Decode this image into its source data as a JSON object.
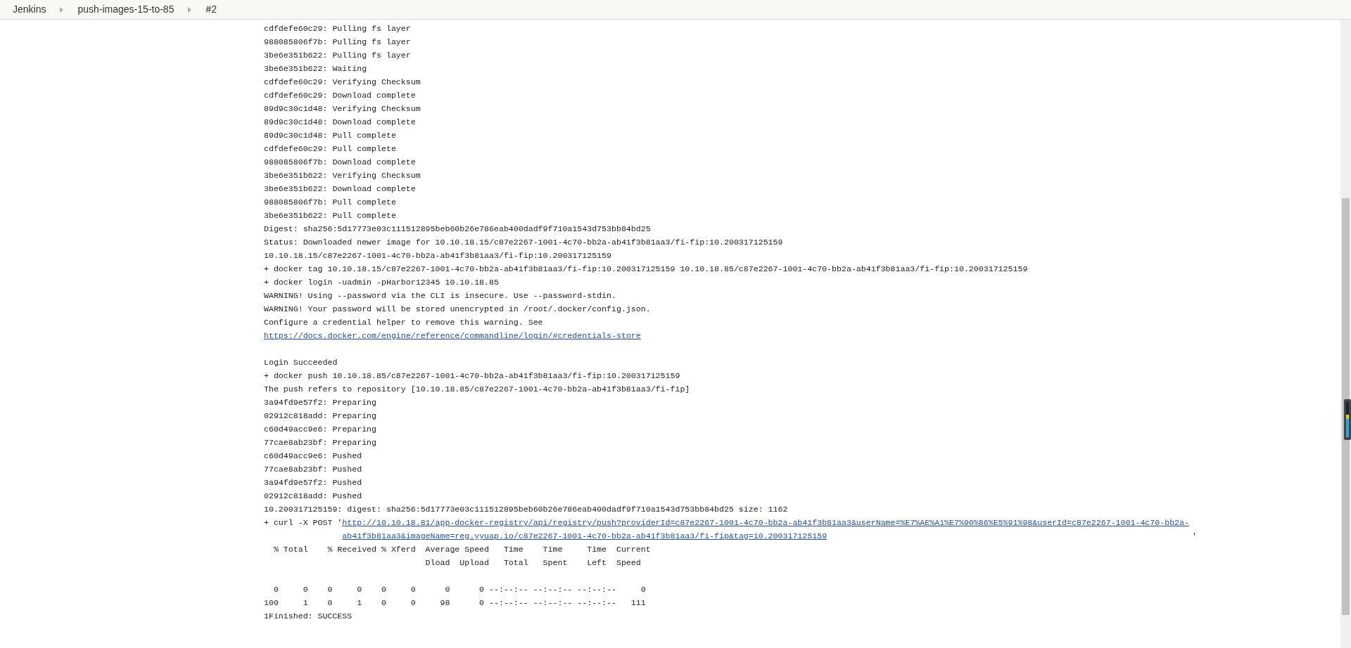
{
  "breadcrumbs": [
    {
      "label": "Jenkins"
    },
    {
      "label": "push-images-15-to-85"
    },
    {
      "label": "#2"
    }
  ],
  "console": [
    {
      "kind": "text",
      "text": "cdfdefe60c29: Pulling fs layer"
    },
    {
      "kind": "text",
      "text": "988085806f7b: Pulling fs layer"
    },
    {
      "kind": "text",
      "text": "3be6e351b622: Pulling fs layer"
    },
    {
      "kind": "text",
      "text": "3be6e351b622: Waiting"
    },
    {
      "kind": "text",
      "text": "cdfdefe60c29: Verifying Checksum"
    },
    {
      "kind": "text",
      "text": "cdfdefe60c29: Download complete"
    },
    {
      "kind": "text",
      "text": "89d9c30c1d48: Verifying Checksum"
    },
    {
      "kind": "text",
      "text": "89d9c30c1d48: Download complete"
    },
    {
      "kind": "text",
      "text": "89d9c30c1d48: Pull complete"
    },
    {
      "kind": "text",
      "text": "cdfdefe60c29: Pull complete"
    },
    {
      "kind": "text",
      "text": "988085806f7b: Download complete"
    },
    {
      "kind": "text",
      "text": "3be6e351b622: Verifying Checksum"
    },
    {
      "kind": "text",
      "text": "3be6e351b622: Download complete"
    },
    {
      "kind": "text",
      "text": "988085806f7b: Pull complete"
    },
    {
      "kind": "text",
      "text": "3be6e351b622: Pull complete"
    },
    {
      "kind": "text",
      "text": "Digest: sha256:5d17773e03c111512895beb60b26e786eab400dadf9f710a1543d753bb84bd25"
    },
    {
      "kind": "text",
      "text": "Status: Downloaded newer image for 10.10.18.15/c87e2267-1001-4c70-bb2a-ab41f3b81aa3/fi-fip:10.200317125159"
    },
    {
      "kind": "text",
      "text": "10.10.18.15/c87e2267-1001-4c70-bb2a-ab41f3b81aa3/fi-fip:10.200317125159"
    },
    {
      "kind": "text",
      "text": "+ docker tag 10.10.18.15/c87e2267-1001-4c70-bb2a-ab41f3b81aa3/fi-fip:10.200317125159 10.10.18.85/c87e2267-1001-4c70-bb2a-ab41f3b81aa3/fi-fip:10.200317125159"
    },
    {
      "kind": "text",
      "text": "+ docker login -uadmin -pHarbor12345 10.10.18.85"
    },
    {
      "kind": "text",
      "text": "WARNING! Using --password via the CLI is insecure. Use --password-stdin."
    },
    {
      "kind": "text",
      "text": "WARNING! Your password will be stored unencrypted in /root/.docker/config.json."
    },
    {
      "kind": "text",
      "text": "Configure a credential helper to remove this warning. See"
    },
    {
      "kind": "link",
      "link": "https://docs.docker.com/engine/reference/commandline/login/#credentials-store"
    },
    {
      "kind": "blank"
    },
    {
      "kind": "text",
      "text": "Login Succeeded"
    },
    {
      "kind": "text",
      "text": "+ docker push 10.10.18.85/c87e2267-1001-4c70-bb2a-ab41f3b81aa3/fi-fip:10.200317125159"
    },
    {
      "kind": "text",
      "text": "The push refers to repository [10.10.18.85/c87e2267-1001-4c70-bb2a-ab41f3b81aa3/fi-fip]"
    },
    {
      "kind": "text",
      "text": "3a94fd9e57f2: Preparing"
    },
    {
      "kind": "text",
      "text": "02912c818add: Preparing"
    },
    {
      "kind": "text",
      "text": "c60d49acc9e6: Preparing"
    },
    {
      "kind": "text",
      "text": "77cae8ab23bf: Preparing"
    },
    {
      "kind": "text",
      "text": "c60d49acc9e6: Pushed"
    },
    {
      "kind": "text",
      "text": "77cae8ab23bf: Pushed"
    },
    {
      "kind": "text",
      "text": "3a94fd9e57f2: Pushed"
    },
    {
      "kind": "text",
      "text": "02912c818add: Pushed"
    },
    {
      "kind": "text",
      "text": "10.200317125159: digest: sha256:5d17773e03c111512895beb60b26e786eab400dadf9f710a1543d753bb84bd25 size: 1162"
    },
    {
      "kind": "link",
      "text": "+ curl -X POST '",
      "link": "http://10.10.18.81/app-docker-registry/api/registry/push?providerId=c87e2267-1001-4c70-bb2a-ab41f3b81aa3&userName=%E7%AE%A1%E7%90%86%E5%91%98&userId=c87e2267-1001-4c70-bb2a-ab41f3b81aa3&imageName=reg.yyuap.io/c87e2267-1001-4c70-bb2a-ab41f3b81aa3/fi-fip&tag=10.200317125159",
      "after": "'"
    },
    {
      "kind": "text",
      "text": "  % Total    % Received % Xferd  Average Speed   Time    Time     Time  Current"
    },
    {
      "kind": "text",
      "text": "                                 Dload  Upload   Total   Spent    Left  Speed"
    },
    {
      "kind": "blank"
    },
    {
      "kind": "text",
      "text": "  0     0    0     0    0     0      0      0 --:--:-- --:--:-- --:--:--     0"
    },
    {
      "kind": "text",
      "text": "100     1    0     1    0     0     98      0 --:--:-- --:--:-- --:--:--   111"
    },
    {
      "kind": "text",
      "text": "1Finished: SUCCESS"
    }
  ]
}
